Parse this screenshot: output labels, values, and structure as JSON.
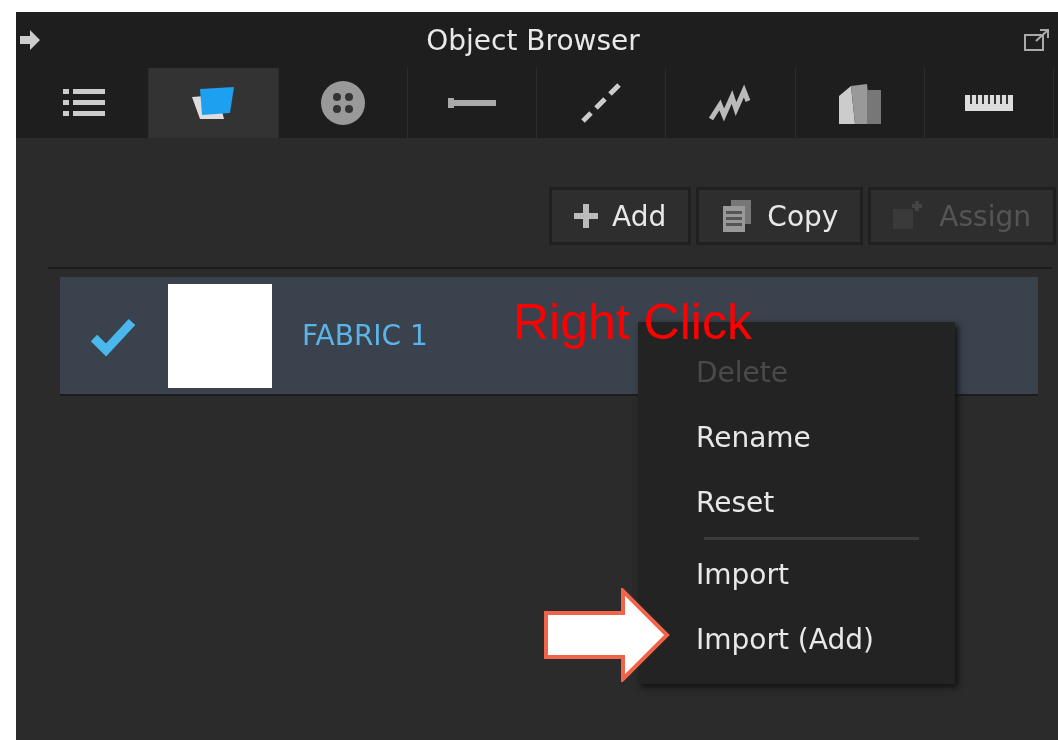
{
  "window": {
    "title": "Object Browser"
  },
  "tabs": [
    {
      "kind": "list",
      "selected": false
    },
    {
      "kind": "fabric",
      "selected": true
    },
    {
      "kind": "button",
      "selected": false
    },
    {
      "kind": "line",
      "selected": false
    },
    {
      "kind": "dashes",
      "selected": false
    },
    {
      "kind": "zigzag",
      "selected": false
    },
    {
      "kind": "stack",
      "selected": false
    },
    {
      "kind": "ruler",
      "selected": false
    }
  ],
  "toolbar": [
    {
      "kind": "add",
      "label": "Add",
      "disabled": false
    },
    {
      "kind": "copy",
      "label": "Copy",
      "disabled": false
    },
    {
      "kind": "assign",
      "label": "Assign",
      "disabled": true
    }
  ],
  "items": [
    {
      "name": "FABRIC 1",
      "checked": true,
      "selected": true
    }
  ],
  "annotation": {
    "text": "Right Click"
  },
  "context_menu": [
    {
      "label": "Delete",
      "disabled": true,
      "separator_before": false
    },
    {
      "label": "Rename",
      "disabled": false,
      "separator_before": false
    },
    {
      "label": "Reset",
      "disabled": false,
      "separator_before": false
    },
    {
      "label": "Import",
      "disabled": false,
      "separator_before": true
    },
    {
      "label": "Import (Add)",
      "disabled": false,
      "separator_before": false
    }
  ]
}
